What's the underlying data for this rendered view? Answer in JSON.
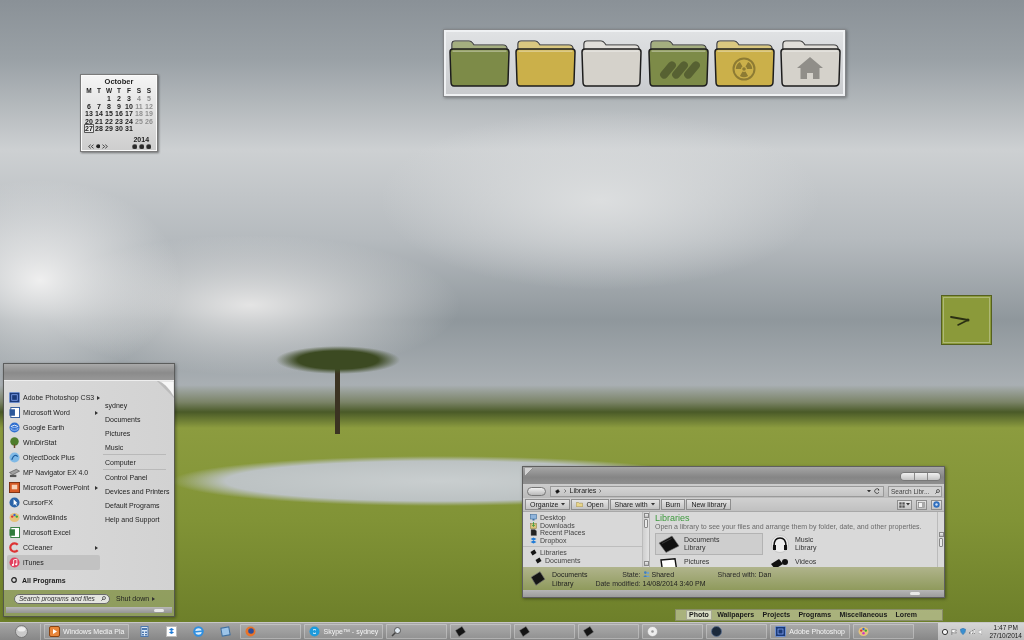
{
  "calendar": {
    "month": "October",
    "weekdays": [
      "M",
      "T",
      "W",
      "T",
      "F",
      "S",
      "S"
    ],
    "weeks": [
      [
        {
          "day": "1",
          "weekend": false,
          "today": false
        },
        {
          "day": "2",
          "weekend": false,
          "today": false
        },
        {
          "day": "3",
          "weekend": false,
          "today": false
        },
        {
          "day": "4",
          "weekend": true,
          "today": false
        },
        {
          "day": "5",
          "weekend": true,
          "today": false
        }
      ],
      [
        {
          "day": "6",
          "weekend": false,
          "today": false
        },
        {
          "day": "7",
          "weekend": false,
          "today": false
        },
        {
          "day": "8",
          "weekend": false,
          "today": false
        },
        {
          "day": "9",
          "weekend": false,
          "today": false
        },
        {
          "day": "10",
          "weekend": false,
          "today": false
        },
        {
          "day": "11",
          "weekend": true,
          "today": false
        },
        {
          "day": "12",
          "weekend": true,
          "today": false
        }
      ],
      [
        {
          "day": "13",
          "weekend": false,
          "today": false
        },
        {
          "day": "14",
          "weekend": false,
          "today": false
        },
        {
          "day": "15",
          "weekend": false,
          "today": false
        },
        {
          "day": "16",
          "weekend": false,
          "today": false
        },
        {
          "day": "17",
          "weekend": false,
          "today": false
        },
        {
          "day": "18",
          "weekend": true,
          "today": false
        },
        {
          "day": "19",
          "weekend": true,
          "today": false
        }
      ],
      [
        {
          "day": "20",
          "weekend": false,
          "today": false
        },
        {
          "day": "21",
          "weekend": false,
          "today": false
        },
        {
          "day": "22",
          "weekend": false,
          "today": false
        },
        {
          "day": "23",
          "weekend": false,
          "today": false
        },
        {
          "day": "24",
          "weekend": false,
          "today": false
        },
        {
          "day": "25",
          "weekend": true,
          "today": false
        },
        {
          "day": "26",
          "weekend": true,
          "today": false
        }
      ],
      [
        {
          "day": "27",
          "weekend": false,
          "today": true
        },
        {
          "day": "28",
          "weekend": false,
          "today": false
        },
        {
          "day": "29",
          "weekend": false,
          "today": false
        },
        {
          "day": "30",
          "weekend": false,
          "today": false
        },
        {
          "day": "31",
          "weekend": false,
          "today": false
        }
      ]
    ],
    "year": "2014"
  },
  "dock": {
    "folders": [
      {
        "color": "#7d8b48",
        "kind": "plain"
      },
      {
        "color": "#cbb04a",
        "kind": "plain"
      },
      {
        "color": "#d5d2cb",
        "kind": "plain"
      },
      {
        "color": "#7d8b48",
        "kind": "stripes"
      },
      {
        "color": "#cbb04a",
        "kind": "radiation"
      },
      {
        "color": "#d5d2cb",
        "kind": "home"
      }
    ]
  },
  "start_menu": {
    "programs": [
      {
        "label": "Adobe Photoshop CS3",
        "submenu": true,
        "selected": false
      },
      {
        "label": "Microsoft Word",
        "submenu": true,
        "selected": false
      },
      {
        "label": "Google Earth",
        "submenu": false,
        "selected": false
      },
      {
        "label": "WinDirStat",
        "submenu": false,
        "selected": false
      },
      {
        "label": "ObjectDock Plus",
        "submenu": false,
        "selected": false
      },
      {
        "label": "MP Navigator EX 4.0",
        "submenu": false,
        "selected": false
      },
      {
        "label": "Microsoft PowerPoint",
        "submenu": true,
        "selected": false
      },
      {
        "label": "CursorFX",
        "submenu": false,
        "selected": false
      },
      {
        "label": "WindowBlinds",
        "submenu": false,
        "selected": false
      },
      {
        "label": "Microsoft Excel",
        "submenu": false,
        "selected": false
      },
      {
        "label": "CCleaner",
        "submenu": true,
        "selected": false
      },
      {
        "label": "iTunes",
        "submenu": false,
        "selected": true
      }
    ],
    "all_programs": "All Programs",
    "place_groups": [
      [
        "sydney",
        "Documents",
        "Pictures",
        "Music"
      ],
      [
        "Computer"
      ],
      [
        "Control Panel",
        "Devices and Printers",
        "Default Programs",
        "Help and Support"
      ]
    ],
    "search": {
      "placeholder": "Search programs and files"
    },
    "shutdown": "Shut down"
  },
  "explorer": {
    "breadcrumb": [
      "Libraries"
    ],
    "search": {
      "placeholder": "Search Libr..."
    },
    "toolbar": [
      {
        "label": "Organize",
        "kind": "menu"
      },
      {
        "label": "Open",
        "kind": "iconic"
      },
      {
        "label": "Share with",
        "kind": "menu"
      },
      {
        "label": "Burn",
        "kind": "plain"
      },
      {
        "label": "New library",
        "kind": "plain"
      }
    ],
    "nav": [
      {
        "children": [
          {
            "label": "Desktop"
          },
          {
            "label": "Downloads"
          },
          {
            "label": "Recent Places"
          },
          {
            "label": "Dropbox"
          }
        ]
      },
      {
        "label": "Libraries",
        "children": [
          {
            "label": "Documents"
          }
        ]
      }
    ],
    "heading": "Libraries",
    "description": "Open a library to see your files and arrange them by folder, date, and other properties.",
    "libraries": [
      {
        "name": "Documents",
        "type": "Library",
        "selected": true
      },
      {
        "name": "Music",
        "type": "Library",
        "selected": false
      },
      {
        "name": "Pictures",
        "selected": false
      },
      {
        "name": "Videos",
        "selected": false
      }
    ],
    "details": {
      "name": "Documents",
      "type": "Library",
      "fields": [
        {
          "kind": "status",
          "label": "State:",
          "value": "Shared"
        },
        {
          "kind": "text",
          "label": "Date modified:",
          "value": "14/08/2014 3:40 PM"
        },
        {
          "kind": "text",
          "label": "Shared with:",
          "value": "Dan"
        }
      ]
    }
  },
  "category_tabs": [
    {
      "label": "Photo",
      "selected": true
    },
    {
      "label": "Wallpapers",
      "selected": false
    },
    {
      "label": "Projects",
      "selected": false
    },
    {
      "label": "Programs",
      "selected": false
    },
    {
      "label": "Miscellaneous",
      "selected": false
    },
    {
      "label": "Lorem",
      "selected": false
    }
  ],
  "taskbar": {
    "items": [
      {
        "kind": "window",
        "label": "Windows Media Pla"
      },
      {
        "kind": "pinned"
      },
      {
        "kind": "pinned"
      },
      {
        "kind": "pinned"
      },
      {
        "kind": "pinned"
      },
      {
        "kind": "window"
      },
      {
        "kind": "window",
        "label": "Skype™ - sydney"
      },
      {
        "kind": "window"
      },
      {
        "kind": "window"
      },
      {
        "kind": "window"
      },
      {
        "kind": "window"
      },
      {
        "kind": "window"
      },
      {
        "kind": "window"
      },
      {
        "kind": "window",
        "label": "Adobe Photoshop"
      },
      {
        "kind": "window"
      }
    ],
    "clock": {
      "time": "1:47 PM",
      "date": "27/10/2014"
    }
  }
}
